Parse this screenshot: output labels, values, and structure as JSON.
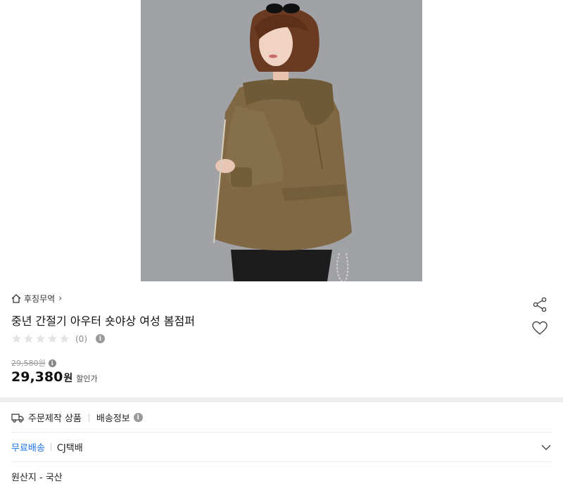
{
  "product_image": {
    "alt": "product-photo"
  },
  "store": {
    "name": "후징무역",
    "chevron": "›"
  },
  "actions": {
    "share_icon": "share-icon",
    "wishlist_icon": "heart-icon"
  },
  "product": {
    "title": "중년 간절기 아우터 숏야상 여성 봄점퍼"
  },
  "rating": {
    "stars_filled": 0,
    "stars_total": 5,
    "count_label": "(0)"
  },
  "pricing": {
    "original_price": "29,580원",
    "sale_price": "29,380",
    "currency": "원",
    "sale_label": "할인가"
  },
  "order_info": {
    "custom_label": "주문제작 상품",
    "delivery_label": "배송정보"
  },
  "shipping": {
    "fee_label": "무료배송",
    "carrier": "CJ택배"
  },
  "origin": {
    "label": "원산지 - 국산"
  },
  "colors": {
    "accent_blue": "#1a73e8",
    "jacket": "#7f6843",
    "hair": "#6b3a22"
  }
}
